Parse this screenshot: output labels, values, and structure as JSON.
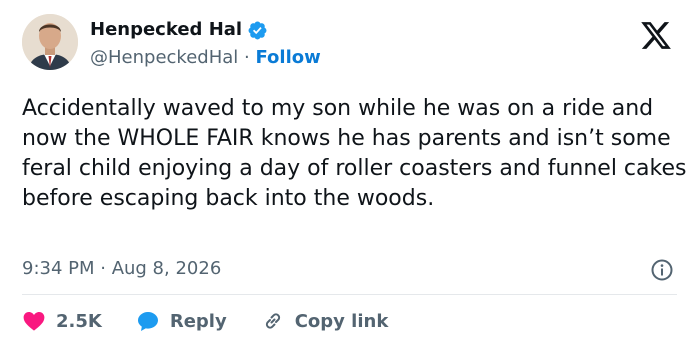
{
  "author": {
    "name": "Henpecked Hal",
    "handle": "@HenpeckedHal",
    "separator": "·",
    "follow_label": "Follow"
  },
  "tweet": {
    "text": "Accidentally waved to my son while he was on a ride and now the WHOLE FAIR knows he has parents and isn’t some feral child enjoying a day of roller coasters and funnel cakes before escaping back into the woods.",
    "timestamp": "9:34 PM · Aug 8, 2026"
  },
  "actions": {
    "like_count": "2.5K",
    "reply_label": "Reply",
    "copy_label": "Copy link"
  },
  "colors": {
    "accent": "#1d9bf0",
    "like": "#f91880",
    "follow": "#0a7bd6",
    "muted": "#536471"
  },
  "icons": [
    "verified-badge-icon",
    "x-logo-icon",
    "info-icon",
    "heart-icon",
    "reply-bubble-icon",
    "link-icon"
  ]
}
